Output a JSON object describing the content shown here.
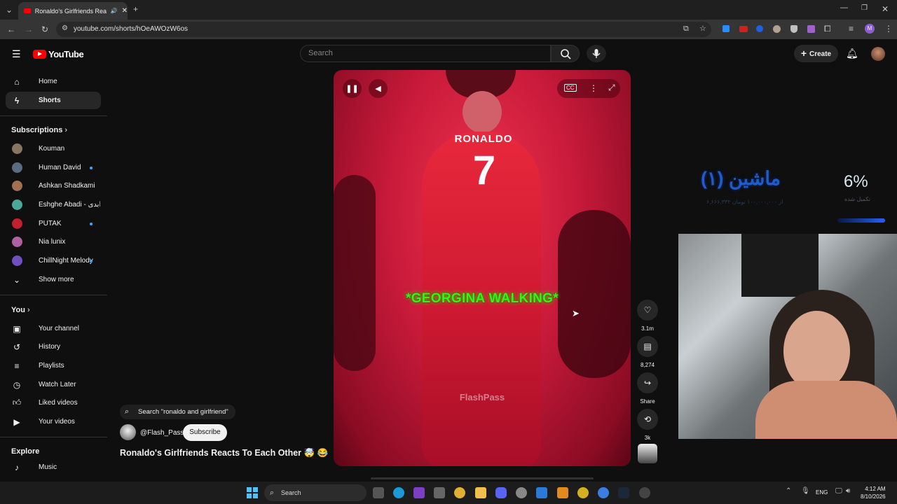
{
  "browser": {
    "tab_title": "Ronaldo's Girlfriends Reacts",
    "url": "youtube.com/shorts/hOeAWOzW6os"
  },
  "youtube": {
    "logo_text": "YouTube",
    "search_placeholder": "Search",
    "create_label": "Create"
  },
  "sidebar": {
    "main": [
      {
        "label": "Home",
        "icon": "home-icon"
      },
      {
        "label": "Shorts",
        "icon": "shorts-icon"
      }
    ],
    "subscriptions_heading": "Subscriptions",
    "subscriptions": [
      {
        "label": "Kouman",
        "color": "#8a7560"
      },
      {
        "label": "Human David",
        "color": "#5a6c80",
        "dot": true
      },
      {
        "label": "Ashkan Shadkami",
        "color": "#a07050"
      },
      {
        "label": "Eshghe Abadi - عشق ابدی",
        "color": "#4aa89a"
      },
      {
        "label": "PUTAK",
        "color": "#c02030",
        "dot": true
      },
      {
        "label": "Nia lunix",
        "color": "#b060a0"
      },
      {
        "label": "ChillNight Melody",
        "color": "#7050c0",
        "dot": true
      }
    ],
    "show_more": "Show more",
    "you_heading": "You",
    "you_items": [
      {
        "label": "Your channel",
        "icon": "channel-icon"
      },
      {
        "label": "History",
        "icon": "history-icon"
      },
      {
        "label": "Playlists",
        "icon": "playlists-icon"
      },
      {
        "label": "Watch Later",
        "icon": "watch-later-icon"
      },
      {
        "label": "Liked videos",
        "icon": "like-icon"
      },
      {
        "label": "Your videos",
        "icon": "your-videos-icon"
      }
    ],
    "explore_heading": "Explore",
    "explore_items": [
      {
        "label": "Music",
        "icon": "music-icon"
      }
    ]
  },
  "short": {
    "search_chip": "Search \"ronaldo and girlfriend\"",
    "channel": "@Flash_Pass",
    "subscribe": "Subscribe",
    "title": "Ronaldo's Girlfriends Reacts To Each Other 🤯 😂",
    "caption": "*GEORGINA WALKING*",
    "watermark": "FlashPass",
    "likes": "3.1m",
    "comments": "8,274",
    "share": "Share",
    "remix": "3k"
  },
  "overlay": {
    "percent": "6%",
    "percent_label": "تکمیل شده",
    "title": "ماشین (۱)",
    "subtitle": "۶,۶۶۶,۳۳۲ از ۱۰۰,۰۰۰,۰۰۰ تومان"
  },
  "taskbar": {
    "search_label": "Search",
    "lang": "ENG",
    "time": "4:12 AM",
    "date": "8/10/2026"
  }
}
